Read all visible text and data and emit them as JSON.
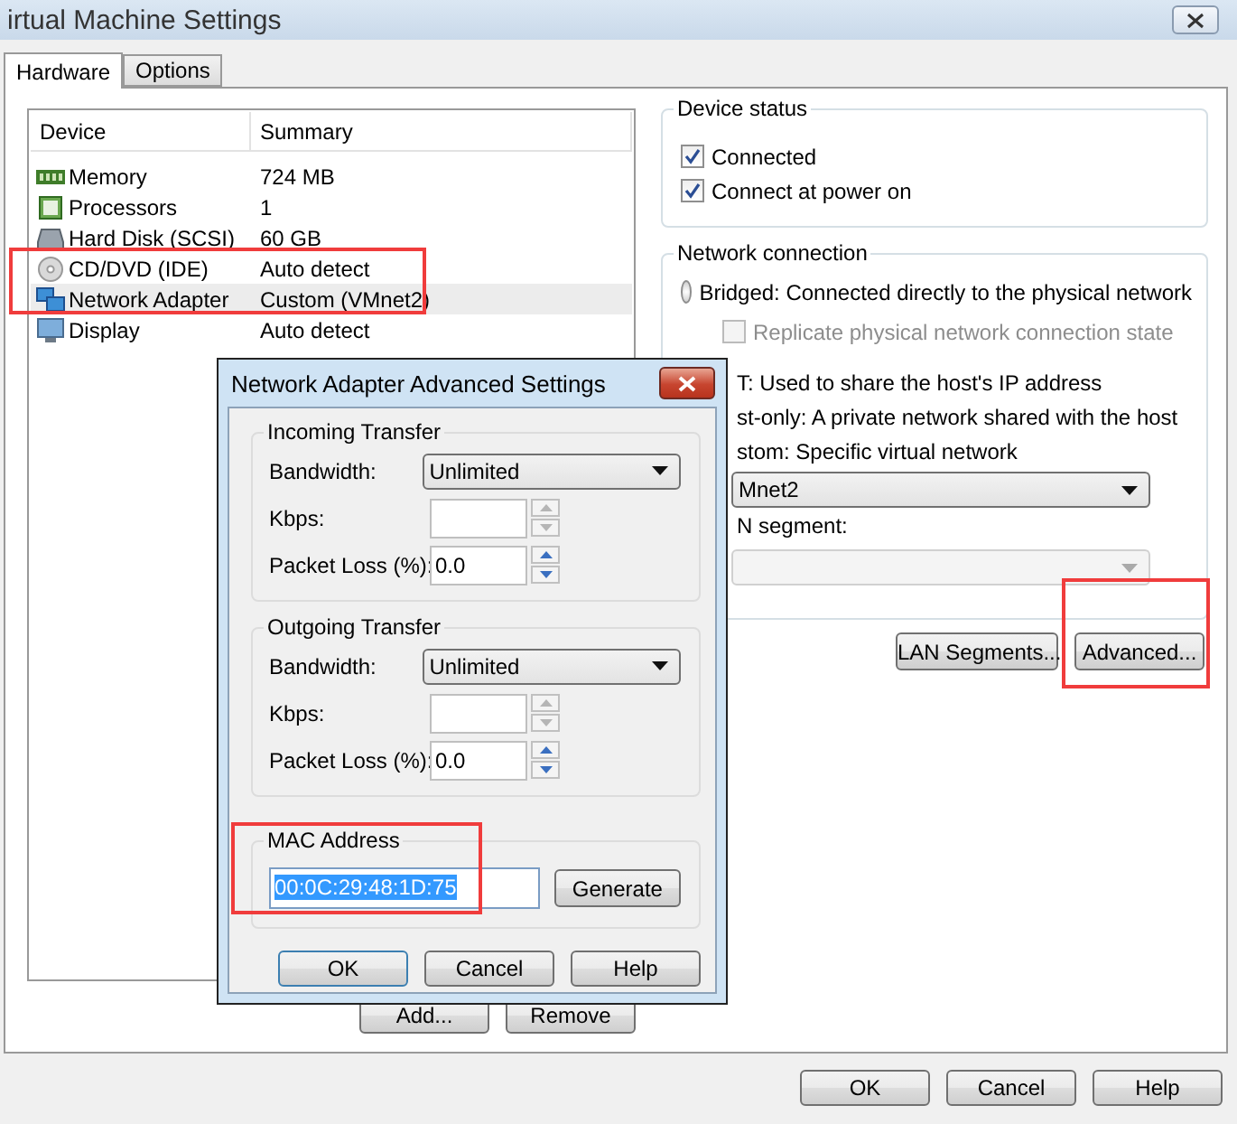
{
  "window": {
    "title": "irtual Machine Settings"
  },
  "tabs": [
    {
      "label": "Hardware",
      "selected": true
    },
    {
      "label": "Options",
      "selected": false
    }
  ],
  "device_table": {
    "columns": [
      "Device",
      "Summary"
    ],
    "rows": [
      {
        "kind": "memory",
        "device": "Memory",
        "summary": "724 MB",
        "selected": false
      },
      {
        "kind": "processor",
        "device": "Processors",
        "summary": "1",
        "selected": false
      },
      {
        "kind": "disk",
        "device": "Hard Disk (SCSI)",
        "summary": "60 GB",
        "selected": false
      },
      {
        "kind": "disc",
        "device": "CD/DVD (IDE)",
        "summary": "Auto detect",
        "selected": false
      },
      {
        "kind": "network",
        "device": "Network Adapter",
        "summary": "Custom (VMnet2)",
        "selected": true
      },
      {
        "kind": "display",
        "device": "Display",
        "summary": "Auto detect",
        "selected": false
      }
    ]
  },
  "device_buttons": [
    "Add...",
    "Remove"
  ],
  "device_status": {
    "title": "Device status",
    "options": [
      {
        "label": "Connected",
        "checked": true
      },
      {
        "label": "Connect at power on",
        "checked": true
      }
    ]
  },
  "network_connection": {
    "title": "Network connection",
    "items": [
      {
        "kind": "radio",
        "label": "Bridged: Connected directly to the physical network",
        "selected": false
      },
      {
        "kind": "checkbox",
        "label": "Replicate physical network connection state",
        "checked": false,
        "disabled": true
      },
      {
        "kind": "text",
        "label": "T: Used to share the host's IP address"
      },
      {
        "kind": "text",
        "label": "st-only: A private network shared with the host"
      },
      {
        "kind": "text",
        "label": "stom: Specific virtual network"
      },
      {
        "kind": "select",
        "value": "Mnet2",
        "disabled": false
      },
      {
        "kind": "text",
        "label": "N segment:"
      },
      {
        "kind": "select",
        "disabled": true
      }
    ]
  },
  "network_buttons": [
    "LAN Segments...",
    "Advanced..."
  ],
  "dialog": {
    "title": "Network Adapter Advanced Settings",
    "groups": [
      {
        "title": "Incoming Transfer",
        "fields": [
          {
            "kind": "select",
            "label": "Bandwidth:",
            "value": "Unlimited"
          },
          {
            "kind": "spin",
            "label": "Kbps:",
            "disabled": true
          },
          {
            "kind": "spin",
            "label": "Packet Loss (%):",
            "value": "0.0",
            "disabled": false
          }
        ]
      },
      {
        "title": "Outgoing Transfer",
        "fields": [
          {
            "kind": "select",
            "label": "Bandwidth:",
            "value": "Unlimited"
          },
          {
            "kind": "spin",
            "label": "Kbps:",
            "disabled": true
          },
          {
            "kind": "spin",
            "label": "Packet Loss (%):",
            "value": "0.0",
            "disabled": false
          }
        ]
      }
    ],
    "mac": {
      "title": "MAC Address",
      "value": "00:0C:29:48:1D:75",
      "selected": true,
      "button": "Generate"
    },
    "buttons": [
      {
        "label": "OK",
        "default": true
      },
      {
        "label": "Cancel",
        "default": false
      },
      {
        "label": "Help",
        "default": false
      }
    ]
  },
  "footer_buttons": [
    "OK",
    "Cancel",
    "Help"
  ],
  "annotations": [
    {
      "kind": "frame"
    },
    {
      "kind": "frame"
    },
    {
      "kind": "frame"
    }
  ]
}
